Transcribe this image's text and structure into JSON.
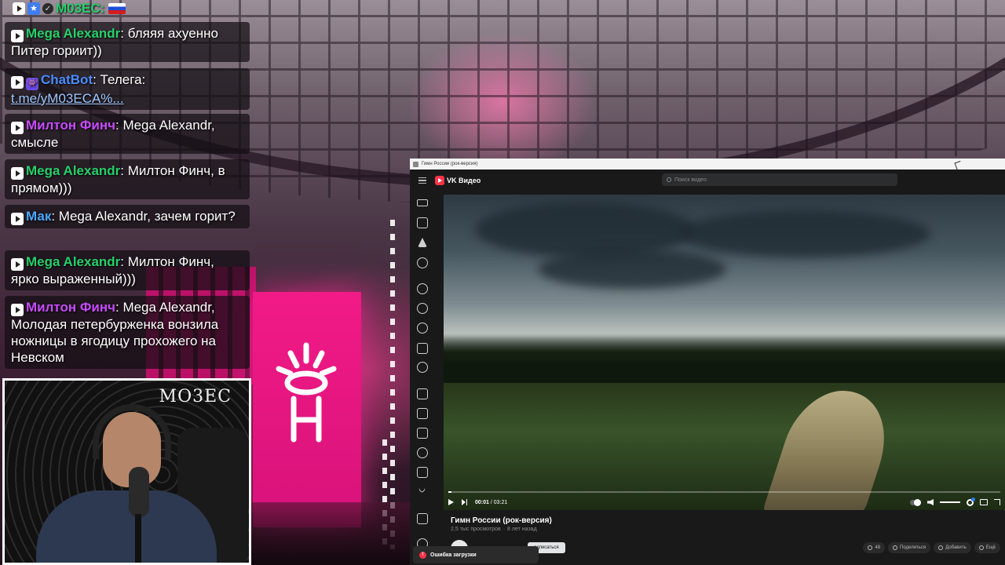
{
  "chat": {
    "top_user": {
      "name": "M03EC:"
    },
    "messages": [
      {
        "name": "Mega Alexandr",
        "name_color": "#27d06a",
        "text": ": бляяя ахуенно Питер гориит))"
      },
      {
        "name": "ChatBot",
        "name_color": "#4a8cff",
        "text": ": Телега:",
        "link": "t.me/yM03ECA%..."
      },
      {
        "name": "Милтон Финч",
        "name_color": "#c84bff",
        "text": ": Mega Alexandr, смысле"
      },
      {
        "name": "Mega Alexandr",
        "name_color": "#27d06a",
        "text": ": Милтон Финч, в прямом)))"
      },
      {
        "name": "Мак",
        "name_color": "#4aa7ff",
        "text": ": Mega Alexandr, зачем горит?"
      },
      {
        "name": "Mega Alexandr",
        "name_color": "#27d06a",
        "text": ": Милтон Финч, ярко выраженный)))"
      },
      {
        "name": "Милтон Финч",
        "name_color": "#c84bff",
        "text": ": Mega Alexandr, Молодая петербурженка вонзила ножницы в ягодицу прохожего на Невском"
      }
    ]
  },
  "webcam": {
    "logo": "MO3EC"
  },
  "vk": {
    "window_title": "Гимн России (рок-версия)",
    "brand": "VK Видео",
    "search_placeholder": "Поиск видео",
    "sidebar_icons": [
      "live-icon",
      "home-icon",
      "bolt-icon",
      "hand-icon",
      "history-icon",
      "clock-icon",
      "heart-icon",
      "playlist-icon",
      "people-icon",
      "translate-icon",
      "book-icon",
      "clapper-icon",
      "music-icon",
      "tv-icon",
      "chevron-down-icon",
      "monitor-icon",
      "info-icon"
    ],
    "player": {
      "current_time": "00:01",
      "duration": "/ 03:21",
      "progress": 0.005
    },
    "video_title": "Гимн России (рок-версия)",
    "views": "2,5 тыс просмотров",
    "age": "8 лет назад",
    "subscribe_label": "одписаться",
    "actions": [
      {
        "label": "48",
        "icon": "heart-icon"
      },
      {
        "label": "Поделиться",
        "icon": "share-icon"
      },
      {
        "label": "Добавить",
        "icon": "plus-icon"
      },
      {
        "label": "Ещё",
        "icon": "more-icon"
      }
    ],
    "error_toast": "Ошибка загрузки",
    "accent": "#ff3347"
  }
}
